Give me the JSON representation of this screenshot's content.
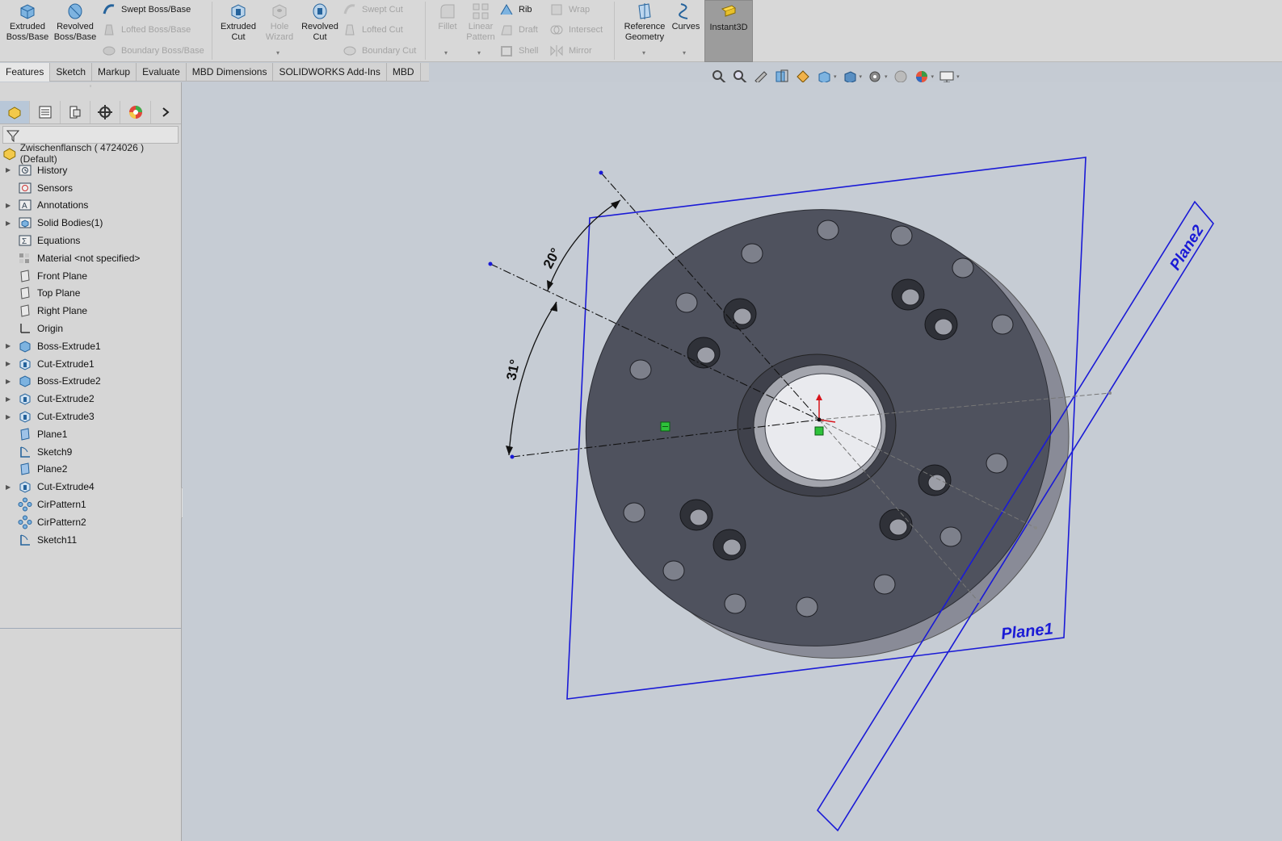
{
  "ribbon": {
    "extruded_boss": "Extruded Boss/Base",
    "revolved_boss": "Revolved Boss/Base",
    "swept_boss": "Swept Boss/Base",
    "lofted_boss": "Lofted Boss/Base",
    "boundary_boss": "Boundary Boss/Base",
    "extruded_cut": "Extruded Cut",
    "hole_wizard": "Hole Wizard",
    "revolved_cut": "Revolved Cut",
    "swept_cut": "Swept Cut",
    "lofted_cut": "Lofted Cut",
    "boundary_cut": "Boundary Cut",
    "fillet": "Fillet",
    "linear_pattern": "Linear Pattern",
    "rib": "Rib",
    "draft": "Draft",
    "shell": "Shell",
    "wrap": "Wrap",
    "intersect": "Intersect",
    "mirror": "Mirror",
    "reference_geometry": "Reference Geometry",
    "curves": "Curves",
    "instant3d": "Instant3D"
  },
  "tabs": [
    "Features",
    "Sketch",
    "Markup",
    "Evaluate",
    "MBD Dimensions",
    "SOLIDWORKS Add-Ins",
    "MBD"
  ],
  "tree": {
    "root": "Zwischenflansch ( 4724026 ) (Default)",
    "items": [
      {
        "label": "History",
        "icon": "history-icon",
        "expandable": true
      },
      {
        "label": "Sensors",
        "icon": "sensor-icon",
        "expandable": false
      },
      {
        "label": "Annotations",
        "icon": "annotation-icon",
        "expandable": true
      },
      {
        "label": "Solid Bodies(1)",
        "icon": "solid-bodies-icon",
        "expandable": true
      },
      {
        "label": "Equations",
        "icon": "equations-icon",
        "expandable": false
      },
      {
        "label": "Material <not specified>",
        "icon": "material-icon",
        "expandable": false
      },
      {
        "label": "Front Plane",
        "icon": "plane-icon",
        "expandable": false
      },
      {
        "label": "Top Plane",
        "icon": "plane-icon",
        "expandable": false
      },
      {
        "label": "Right Plane",
        "icon": "plane-icon",
        "expandable": false
      },
      {
        "label": "Origin",
        "icon": "origin-icon",
        "expandable": false
      },
      {
        "label": "Boss-Extrude1",
        "icon": "boss-extrude-icon",
        "expandable": true
      },
      {
        "label": "Cut-Extrude1",
        "icon": "cut-extrude-icon",
        "expandable": true
      },
      {
        "label": "Boss-Extrude2",
        "icon": "boss-extrude-icon",
        "expandable": true
      },
      {
        "label": "Cut-Extrude2",
        "icon": "cut-extrude-icon",
        "expandable": true
      },
      {
        "label": "Cut-Extrude3",
        "icon": "cut-extrude-icon",
        "expandable": true
      },
      {
        "label": "Plane1",
        "icon": "ref-plane-icon",
        "expandable": false
      },
      {
        "label": "Sketch9",
        "icon": "sketch-icon",
        "expandable": false
      },
      {
        "label": "Plane2",
        "icon": "ref-plane-icon",
        "expandable": false
      },
      {
        "label": "Cut-Extrude4",
        "icon": "cut-extrude-icon",
        "expandable": true
      },
      {
        "label": "CirPattern1",
        "icon": "circular-pattern-icon",
        "expandable": false
      },
      {
        "label": "CirPattern2",
        "icon": "circular-pattern-icon",
        "expandable": false
      },
      {
        "label": "Sketch11",
        "icon": "sketch-icon",
        "expandable": false
      }
    ]
  },
  "viewport": {
    "dim_angle_1": "20°",
    "dim_angle_2": "31°",
    "plane1_label": "Plane1",
    "plane2_label": "Plane2"
  },
  "colors": {
    "part_face": "#4f525e",
    "part_side": "#868894",
    "plane_blue": "#1a1ad6",
    "viewport_bg": "#c6ccd4"
  }
}
